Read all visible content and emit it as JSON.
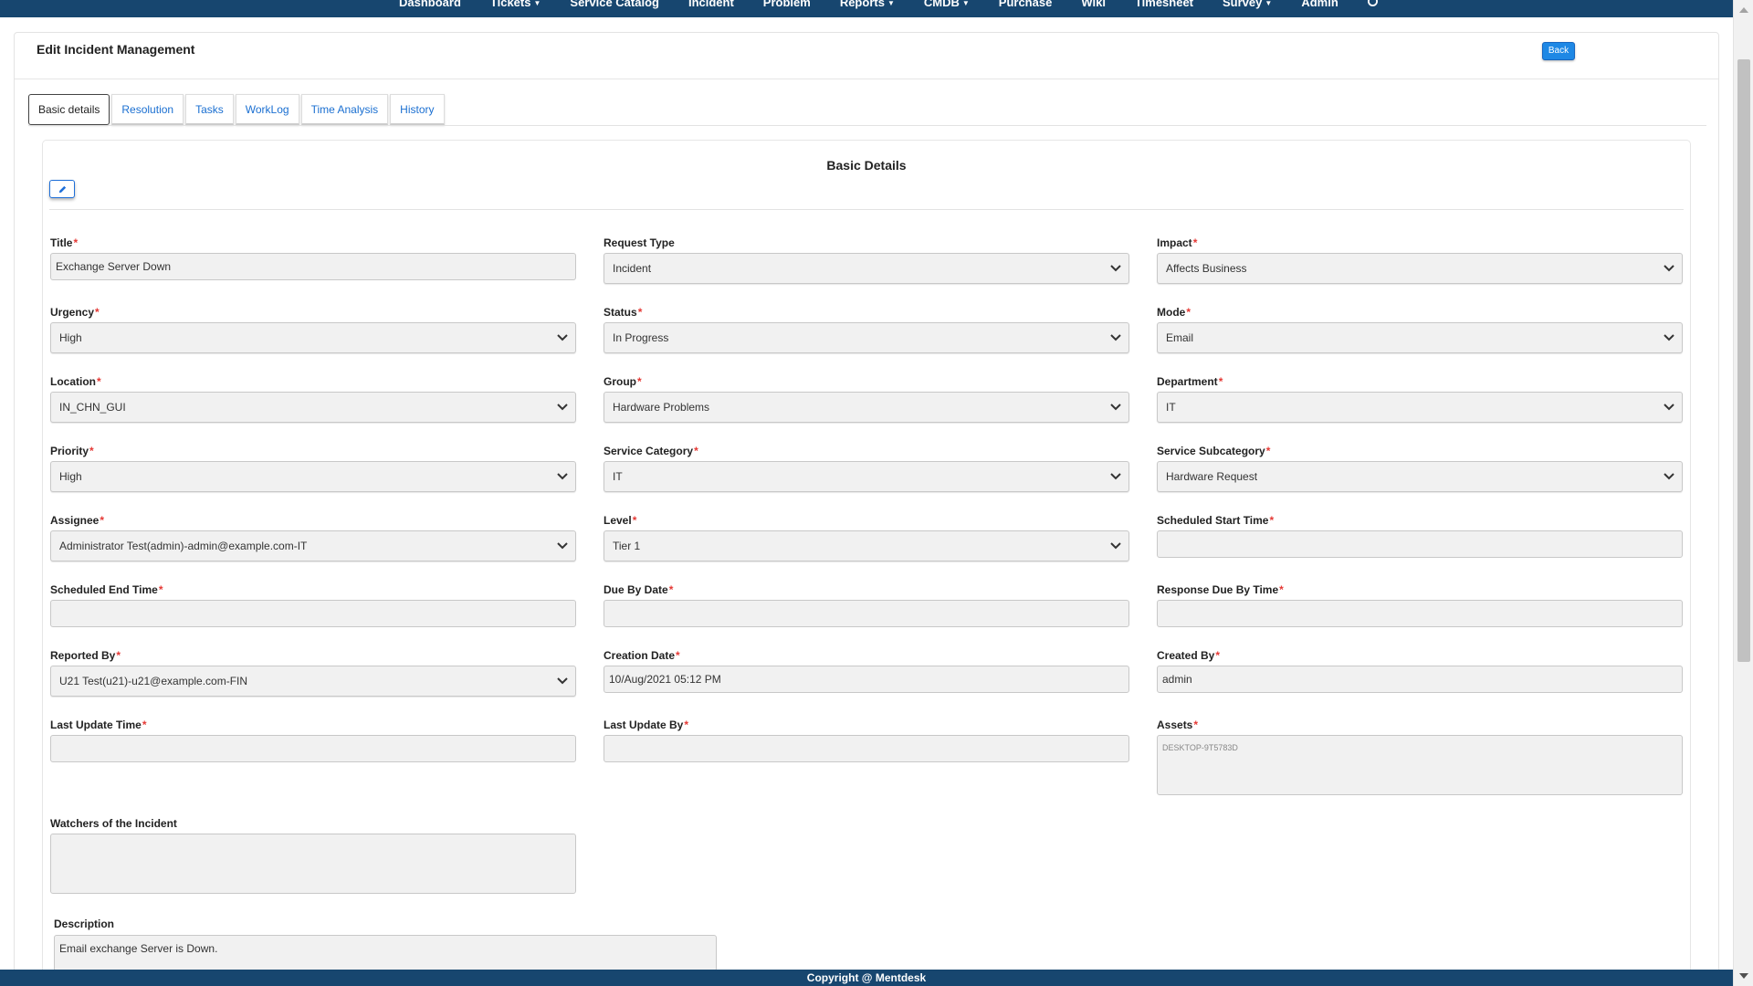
{
  "nav": {
    "items": [
      {
        "label": "Dashboard",
        "dropdown": false
      },
      {
        "label": "Tickets",
        "dropdown": true
      },
      {
        "label": "Service Catalog",
        "dropdown": false
      },
      {
        "label": "Incident",
        "dropdown": false
      },
      {
        "label": "Problem",
        "dropdown": false
      },
      {
        "label": "Reports",
        "dropdown": true
      },
      {
        "label": "CMDB",
        "dropdown": true
      },
      {
        "label": "Purchase",
        "dropdown": false
      },
      {
        "label": "Wiki",
        "dropdown": false
      },
      {
        "label": "Timesheet",
        "dropdown": false
      },
      {
        "label": "Survey",
        "dropdown": true
      },
      {
        "label": "Admin",
        "dropdown": false
      }
    ],
    "icon": "user-icon"
  },
  "header": {
    "title": "Edit Incident Management",
    "back_label": "Back"
  },
  "tabs": [
    {
      "label": "Basic details",
      "active": true
    },
    {
      "label": "Resolution",
      "active": false
    },
    {
      "label": "Tasks",
      "active": false
    },
    {
      "label": "WorkLog",
      "active": false
    },
    {
      "label": "Time Analysis",
      "active": false
    },
    {
      "label": "History",
      "active": false
    }
  ],
  "section": {
    "title": "Basic Details",
    "edit_icon": "pencil-icon"
  },
  "fields": {
    "title": {
      "label": "Title",
      "value": "Exchange Server Down"
    },
    "request_type": {
      "label": "Request Type",
      "value": "Incident"
    },
    "impact": {
      "label": "Impact",
      "value": "Affects Business"
    },
    "urgency": {
      "label": "Urgency",
      "value": "High"
    },
    "status": {
      "label": "Status",
      "value": "In Progress"
    },
    "mode": {
      "label": "Mode",
      "value": "Email"
    },
    "location": {
      "label": "Location",
      "value": "IN_CHN_GUI"
    },
    "group": {
      "label": "Group",
      "value": "Hardware Problems"
    },
    "department": {
      "label": "Department",
      "value": "IT"
    },
    "priority": {
      "label": "Priority",
      "value": "High"
    },
    "service_category": {
      "label": "Service Category",
      "value": "IT"
    },
    "service_subcategory": {
      "label": "Service Subcategory",
      "value": "Hardware Request"
    },
    "assignee": {
      "label": "Assignee",
      "value": "Administrator Test(admin)-admin@example.com-IT"
    },
    "level": {
      "label": "Level",
      "value": "Tier 1"
    },
    "scheduled_start": {
      "label": "Scheduled Start Time",
      "value": ""
    },
    "scheduled_end": {
      "label": "Scheduled End Time",
      "value": ""
    },
    "due_by_date": {
      "label": "Due By Date",
      "value": ""
    },
    "response_due": {
      "label": "Response Due By Time",
      "value": ""
    },
    "reported_by": {
      "label": "Reported By",
      "value": "U21 Test(u21)-u21@example.com-FIN"
    },
    "creation_date": {
      "label": "Creation Date",
      "value": "10/Aug/2021 05:12 PM"
    },
    "created_by": {
      "label": "Created By",
      "value": "admin"
    },
    "last_update_time": {
      "label": "Last Update Time",
      "value": ""
    },
    "last_update_by": {
      "label": "Last Update By",
      "value": ""
    },
    "assets": {
      "label": "Assets",
      "value": "DESKTOP-9T5783D"
    },
    "watchers": {
      "label": "Watchers of the Incident",
      "value": ""
    },
    "description": {
      "label": "Description",
      "value": "Email exchange Server is Down."
    }
  },
  "footer": {
    "text": "Copyright @ Mentdesk"
  },
  "colors": {
    "nav_bg": "#17466f",
    "accent": "#1e88e5",
    "required": "#e53935",
    "link": "#1a6fd1"
  }
}
